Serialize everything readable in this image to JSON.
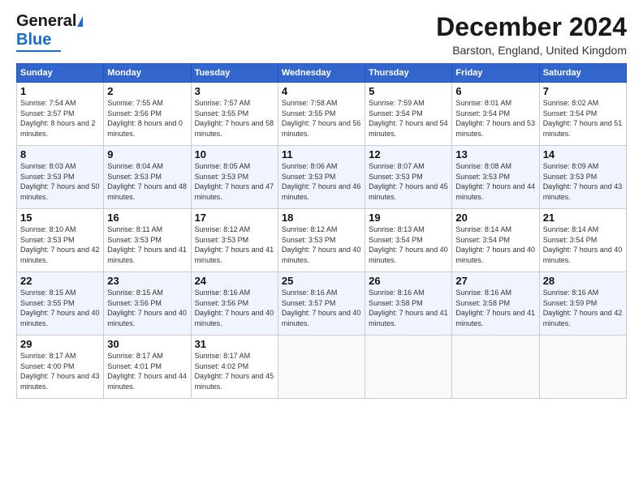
{
  "logo": {
    "general": "General",
    "blue": "Blue"
  },
  "title": "December 2024",
  "location": "Barston, England, United Kingdom",
  "headers": [
    "Sunday",
    "Monday",
    "Tuesday",
    "Wednesday",
    "Thursday",
    "Friday",
    "Saturday"
  ],
  "weeks": [
    [
      {
        "day": "1",
        "sunrise": "7:54 AM",
        "sunset": "3:57 PM",
        "daylight": "8 hours and 2 minutes."
      },
      {
        "day": "2",
        "sunrise": "7:55 AM",
        "sunset": "3:56 PM",
        "daylight": "8 hours and 0 minutes."
      },
      {
        "day": "3",
        "sunrise": "7:57 AM",
        "sunset": "3:55 PM",
        "daylight": "7 hours and 58 minutes."
      },
      {
        "day": "4",
        "sunrise": "7:58 AM",
        "sunset": "3:55 PM",
        "daylight": "7 hours and 56 minutes."
      },
      {
        "day": "5",
        "sunrise": "7:59 AM",
        "sunset": "3:54 PM",
        "daylight": "7 hours and 54 minutes."
      },
      {
        "day": "6",
        "sunrise": "8:01 AM",
        "sunset": "3:54 PM",
        "daylight": "7 hours and 53 minutes."
      },
      {
        "day": "7",
        "sunrise": "8:02 AM",
        "sunset": "3:54 PM",
        "daylight": "7 hours and 51 minutes."
      }
    ],
    [
      {
        "day": "8",
        "sunrise": "8:03 AM",
        "sunset": "3:53 PM",
        "daylight": "7 hours and 50 minutes."
      },
      {
        "day": "9",
        "sunrise": "8:04 AM",
        "sunset": "3:53 PM",
        "daylight": "7 hours and 48 minutes."
      },
      {
        "day": "10",
        "sunrise": "8:05 AM",
        "sunset": "3:53 PM",
        "daylight": "7 hours and 47 minutes."
      },
      {
        "day": "11",
        "sunrise": "8:06 AM",
        "sunset": "3:53 PM",
        "daylight": "7 hours and 46 minutes."
      },
      {
        "day": "12",
        "sunrise": "8:07 AM",
        "sunset": "3:53 PM",
        "daylight": "7 hours and 45 minutes."
      },
      {
        "day": "13",
        "sunrise": "8:08 AM",
        "sunset": "3:53 PM",
        "daylight": "7 hours and 44 minutes."
      },
      {
        "day": "14",
        "sunrise": "8:09 AM",
        "sunset": "3:53 PM",
        "daylight": "7 hours and 43 minutes."
      }
    ],
    [
      {
        "day": "15",
        "sunrise": "8:10 AM",
        "sunset": "3:53 PM",
        "daylight": "7 hours and 42 minutes."
      },
      {
        "day": "16",
        "sunrise": "8:11 AM",
        "sunset": "3:53 PM",
        "daylight": "7 hours and 41 minutes."
      },
      {
        "day": "17",
        "sunrise": "8:12 AM",
        "sunset": "3:53 PM",
        "daylight": "7 hours and 41 minutes."
      },
      {
        "day": "18",
        "sunrise": "8:12 AM",
        "sunset": "3:53 PM",
        "daylight": "7 hours and 40 minutes."
      },
      {
        "day": "19",
        "sunrise": "8:13 AM",
        "sunset": "3:54 PM",
        "daylight": "7 hours and 40 minutes."
      },
      {
        "day": "20",
        "sunrise": "8:14 AM",
        "sunset": "3:54 PM",
        "daylight": "7 hours and 40 minutes."
      },
      {
        "day": "21",
        "sunrise": "8:14 AM",
        "sunset": "3:54 PM",
        "daylight": "7 hours and 40 minutes."
      }
    ],
    [
      {
        "day": "22",
        "sunrise": "8:15 AM",
        "sunset": "3:55 PM",
        "daylight": "7 hours and 40 minutes."
      },
      {
        "day": "23",
        "sunrise": "8:15 AM",
        "sunset": "3:56 PM",
        "daylight": "7 hours and 40 minutes."
      },
      {
        "day": "24",
        "sunrise": "8:16 AM",
        "sunset": "3:56 PM",
        "daylight": "7 hours and 40 minutes."
      },
      {
        "day": "25",
        "sunrise": "8:16 AM",
        "sunset": "3:57 PM",
        "daylight": "7 hours and 40 minutes."
      },
      {
        "day": "26",
        "sunrise": "8:16 AM",
        "sunset": "3:58 PM",
        "daylight": "7 hours and 41 minutes."
      },
      {
        "day": "27",
        "sunrise": "8:16 AM",
        "sunset": "3:58 PM",
        "daylight": "7 hours and 41 minutes."
      },
      {
        "day": "28",
        "sunrise": "8:16 AM",
        "sunset": "3:59 PM",
        "daylight": "7 hours and 42 minutes."
      }
    ],
    [
      {
        "day": "29",
        "sunrise": "8:17 AM",
        "sunset": "4:00 PM",
        "daylight": "7 hours and 43 minutes."
      },
      {
        "day": "30",
        "sunrise": "8:17 AM",
        "sunset": "4:01 PM",
        "daylight": "7 hours and 44 minutes."
      },
      {
        "day": "31",
        "sunrise": "8:17 AM",
        "sunset": "4:02 PM",
        "daylight": "7 hours and 45 minutes."
      },
      null,
      null,
      null,
      null
    ]
  ]
}
